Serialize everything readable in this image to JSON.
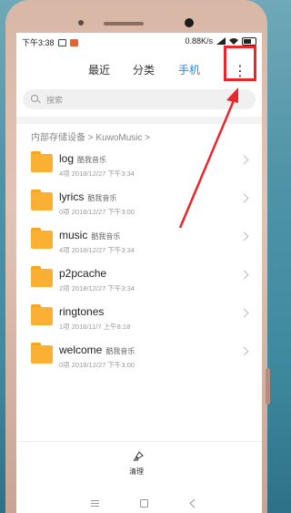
{
  "status_bar": {
    "time": "下午3:38",
    "network_speed": "0.88K/s",
    "icons": [
      "camera-status-icon",
      "app-status-icon",
      "signal-icon",
      "wifi-icon",
      "battery-icon"
    ]
  },
  "tabs": [
    {
      "label": "最近",
      "active": false
    },
    {
      "label": "分类",
      "active": false
    },
    {
      "label": "手机",
      "active": true
    }
  ],
  "more_button": {
    "glyph": "⋮",
    "icon": "more-vertical-icon"
  },
  "search": {
    "placeholder": "搜索"
  },
  "breadcrumb": "内部存储设备 > KuwoMusic >",
  "folders": [
    {
      "name": "log",
      "tag": "酷我音乐",
      "meta": "4项  2018/12/27 下午3:34"
    },
    {
      "name": "lyrics",
      "tag": "酷我音乐",
      "meta": "0项  2018/12/27 下午3:00"
    },
    {
      "name": "music",
      "tag": "酷我音乐",
      "meta": "4项  2018/12/27 下午3:34"
    },
    {
      "name": "p2pcache",
      "tag": "",
      "meta": "2项  2018/12/27 下午3:34"
    },
    {
      "name": "ringtones",
      "tag": "",
      "meta": "1项  2016/11/7 上午8:18"
    },
    {
      "name": "welcome",
      "tag": "酷我音乐",
      "meta": "0项  2018/12/27 下午3:00"
    }
  ],
  "clean_button": {
    "label": "清理",
    "icon": "brush-icon"
  },
  "colors": {
    "accent": "#1f8ce8",
    "folder": "#fbb034",
    "annotation": "#e8262c"
  }
}
